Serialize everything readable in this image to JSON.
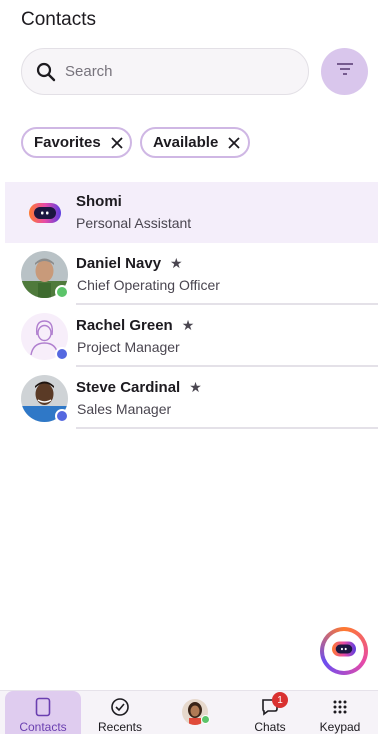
{
  "header": {
    "title": "Contacts"
  },
  "search": {
    "placeholder": "Search",
    "value": ""
  },
  "filters": [
    {
      "label": "Favorites"
    },
    {
      "label": "Available"
    }
  ],
  "contacts": [
    {
      "name": "Shomi",
      "subtitle": "Personal Assistant",
      "favorite": false,
      "status": null,
      "avatar": "assistant-logo"
    },
    {
      "name": "Daniel Navy",
      "subtitle": "Chief Operating Officer",
      "favorite": true,
      "status": "available",
      "avatar": "photo"
    },
    {
      "name": "Rachel Green",
      "subtitle": "Project Manager",
      "favorite": true,
      "status": "busy",
      "avatar": "line-illustration"
    },
    {
      "name": "Steve Cardinal",
      "subtitle": "Sales Manager",
      "favorite": true,
      "status": "busy",
      "avatar": "photo"
    }
  ],
  "star_glyph": "★",
  "nav": {
    "contacts": "Contacts",
    "recents": "Recents",
    "chats": "Chats",
    "chats_badge": "1",
    "keypad": "Keypad"
  },
  "colors": {
    "accent": "#d9c6ec",
    "highlight": "#f4eefa",
    "status_available": "#5cc46a",
    "status_busy": "#5568e0",
    "badge": "#d93131"
  }
}
